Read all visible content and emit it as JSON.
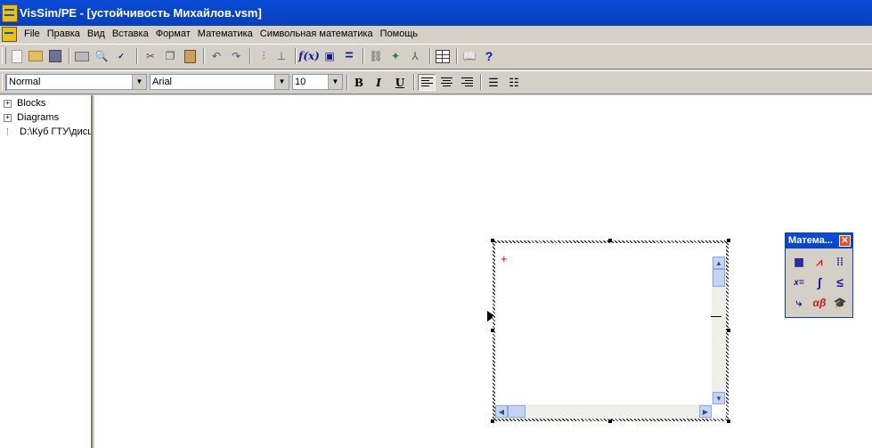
{
  "window": {
    "title": "VisSim/PE - [устойчивость Михайлов.vsm]"
  },
  "menu": {
    "items": [
      "File",
      "Правка",
      "Вид",
      "Вставка",
      "Формат",
      "Математика",
      "Символьная математика",
      "Помощь"
    ]
  },
  "format_bar": {
    "style_value": "Normal",
    "font_value": "Arial",
    "size_value": "10",
    "bold_label": "B",
    "italic_label": "I",
    "underline_label": "U"
  },
  "toolbar": {
    "fx_label": "f(x)",
    "help_label": "?"
  },
  "tree": {
    "items": [
      {
        "label": "Blocks",
        "expander": "+"
      },
      {
        "label": "Diagrams",
        "expander": "+"
      },
      {
        "label": "D:\\Куб ГТУ\\дисц"
      }
    ]
  },
  "palette": {
    "title": "Матема...",
    "close_label": "✕",
    "buttons": [
      "calculator",
      "graph",
      "matrix",
      "x=",
      "∫",
      "≤",
      "vector",
      "αβ",
      "cap"
    ]
  },
  "embed": {
    "crosshair": "+"
  },
  "colors": {
    "titlebar": "#0a4bd6",
    "chrome": "#d4d0c8",
    "crosshair": "#d00000"
  }
}
